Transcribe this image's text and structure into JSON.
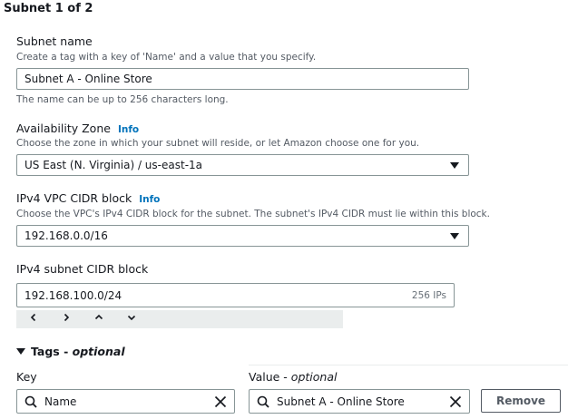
{
  "section": {
    "title": "Subnet 1 of 2"
  },
  "subnet_name": {
    "label": "Subnet name",
    "description": "Create a tag with a key of 'Name' and a value that you specify.",
    "value": "Subnet A - Online Store",
    "constraint": "The name can be up to 256 characters long."
  },
  "availability_zone": {
    "label": "Availability Zone",
    "info": "Info",
    "description": "Choose the zone in which your subnet will reside, or let Amazon choose one for you.",
    "selected": "US East (N. Virginia) / us-east-1a"
  },
  "vpc_cidr": {
    "label": "IPv4 VPC CIDR block",
    "info": "Info",
    "description": "Choose the VPC's IPv4 CIDR block for the subnet. The subnet's IPv4 CIDR must lie within this block.",
    "selected": "192.168.0.0/16"
  },
  "subnet_cidr": {
    "label": "IPv4 subnet CIDR block",
    "value": "192.168.100.0/24",
    "suffix": "256 IPs",
    "stepper": {
      "left": "<",
      "right": ">",
      "up": "^",
      "down": "v"
    }
  },
  "tags": {
    "title": "Tags - ",
    "title_optional": "optional",
    "key_label": "Key",
    "value_label": "Value - ",
    "value_label_optional": "optional",
    "key_value": "Name",
    "value_value": "Subnet A - Online Store",
    "remove_label": "Remove"
  },
  "colors": {
    "link": "#0073bb",
    "border": "#879596",
    "stepper_bg": "#eaeded"
  }
}
